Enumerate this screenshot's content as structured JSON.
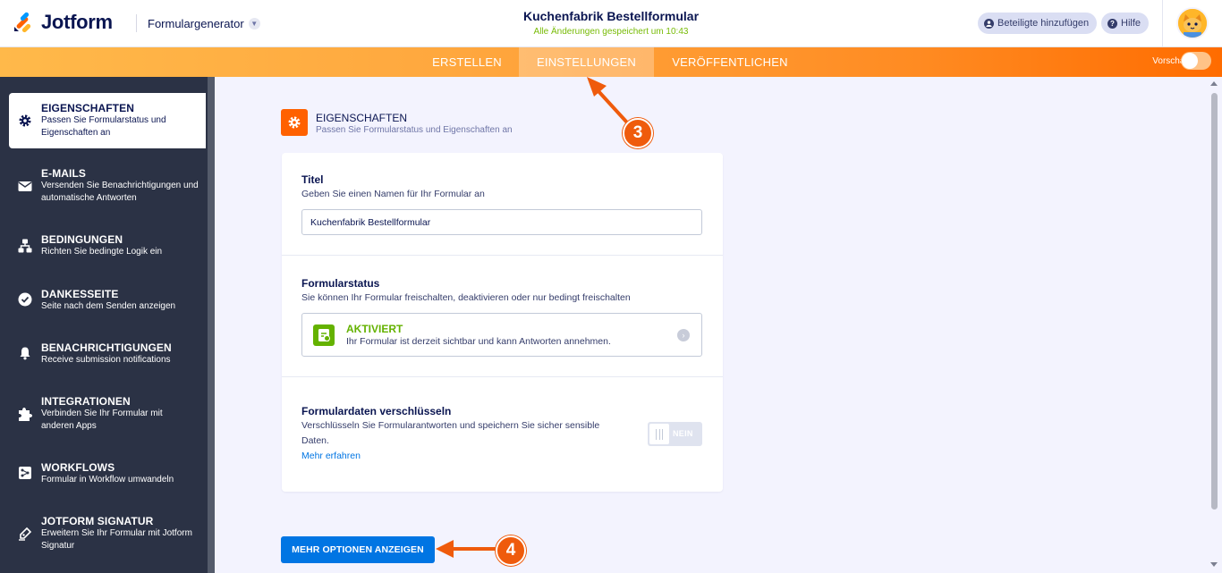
{
  "header": {
    "brand": "Jotform",
    "builder_label": "Formulargenerator",
    "form_title": "Kuchenfabrik Bestellformular",
    "save_status": "Alle Änderungen gespeichert um 10:43",
    "add_participants_label": "Beteiligte hinzufügen",
    "help_label": "Hilfe"
  },
  "nav": {
    "tabs": [
      {
        "label": "ERSTELLEN"
      },
      {
        "label": "EINSTELLUNGEN"
      },
      {
        "label": "VERÖFFENTLICHEN"
      }
    ],
    "preview_label": "Vorschau"
  },
  "sidebar": {
    "items": [
      {
        "title": "EIGENSCHAFTEN",
        "desc": "Passen Sie Formularstatus und Eigenschaften an",
        "icon": "gear-icon"
      },
      {
        "title": "E-MAILS",
        "desc": "Versenden Sie Benachrichtigungen und automatische Antworten",
        "icon": "envelope-icon"
      },
      {
        "title": "BEDINGUNGEN",
        "desc": "Richten Sie bedingte Logik ein",
        "icon": "hierarchy-icon"
      },
      {
        "title": "DANKESSEITE",
        "desc": "Seite nach dem Senden anzeigen",
        "icon": "checkmark-circle-icon"
      },
      {
        "title": "BENACHRICHTIGUNGEN",
        "desc": "Receive submission notifications",
        "icon": "bell-icon"
      },
      {
        "title": "INTEGRATIONEN",
        "desc": "Verbinden Sie Ihr Formular mit anderen Apps",
        "icon": "puzzle-icon"
      },
      {
        "title": "WORKFLOWS",
        "desc": "Formular in Workflow umwandeln",
        "icon": "workflow-icon"
      },
      {
        "title": "JOTFORM SIGNATUR",
        "desc": "Erweitern Sie Ihr Formular mit Jotform Signatur",
        "icon": "pen-icon"
      }
    ]
  },
  "section": {
    "title": "EIGENSCHAFTEN",
    "subtitle": "Passen Sie Formularstatus und Eigenschaften an"
  },
  "fields": {
    "title_label": "Titel",
    "title_desc": "Geben Sie einen Namen für Ihr Formular an",
    "title_value": "Kuchenfabrik Bestellformular",
    "status_label": "Formularstatus",
    "status_desc": "Sie können Ihr Formular freischalten, deaktivieren oder nur bedingt freischalten",
    "status_value": "AKTIVIERT",
    "status_value_desc": "Ihr Formular ist derzeit sichtbar und kann Antworten annehmen.",
    "encrypt_label": "Formulardaten verschlüsseln",
    "encrypt_desc": "Verschlüsseln Sie Formularantworten und speichern Sie sicher sensible Daten.",
    "learn_more": "Mehr erfahren",
    "encrypt_toggle": "NEIN"
  },
  "more_options_label": "MEHR OPTIONEN ANZEIGEN",
  "annotations": [
    "3",
    "4"
  ],
  "colors": {
    "accent_orange": "#ff6100",
    "primary_blue": "#0075e3",
    "active_green": "#64b200",
    "sidebar_bg": "#2b3245",
    "saved_green": "#78bb07"
  }
}
